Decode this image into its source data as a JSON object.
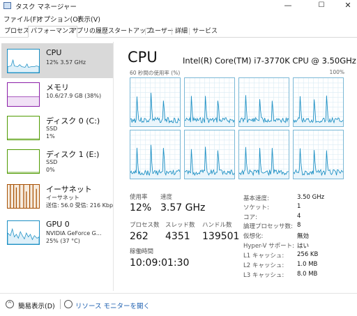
{
  "window": {
    "title": "タスク マネージャー",
    "minimize": "—",
    "maximize": "☐",
    "close": "✕"
  },
  "menu": [
    "ファイル(F)",
    "オプション(O)",
    "表示(V)"
  ],
  "tabs": [
    "プロセス",
    "パフォーマンス",
    "アプリの履歴",
    "スタートアップ",
    "ユーザー",
    "詳細",
    "サービス"
  ],
  "active_tab": "パフォーマンス",
  "sidebar": [
    {
      "name": "CPU",
      "sub1": "12%  3.57 GHz",
      "sub2": "",
      "sub3": "",
      "color": "#1b8fc4",
      "icon": "cpu-graph-icon"
    },
    {
      "name": "メモリ",
      "sub1": "10.6/27.9 GB (38%)",
      "sub2": "",
      "sub3": "",
      "color": "#8b1fa8",
      "icon": "memory-graph-icon"
    },
    {
      "name": "ディスク 0 (C:)",
      "sub1": "SSD",
      "sub2": "1%",
      "sub3": "",
      "color": "#4f9a00",
      "icon": "disk-graph-icon"
    },
    {
      "name": "ディスク 1 (E:)",
      "sub1": "SSD",
      "sub2": "0%",
      "sub3": "",
      "color": "#4f9a00",
      "icon": "disk-graph-icon"
    },
    {
      "name": "イーサネット",
      "sub1": "イーサネット",
      "sub2": "送信: 56.0  受信: 216 Kbp",
      "sub3": "",
      "color": "#a74f01",
      "icon": "ethernet-graph-icon"
    },
    {
      "name": "GPU 0",
      "sub1": "NVIDIA GeForce G...",
      "sub2": "25% (37 °C)",
      "sub3": "",
      "color": "#1b8fc4",
      "icon": "gpu-graph-icon"
    }
  ],
  "main": {
    "title": "CPU",
    "model": "Intel(R) Core(TM) i7-3770K CPU @ 3.50GHz",
    "graph_label": "60 秒間の使用率 (%)",
    "graph_max": "100%",
    "utilization_label": "使用率",
    "utilization": "12%",
    "speed_label": "速度",
    "speed": "3.57 GHz",
    "processes_label": "プロセス数",
    "processes": "262",
    "threads_label": "スレッド数",
    "threads": "4351",
    "handles_label": "ハンドル数",
    "handles": "139501",
    "uptime_label": "稼働時間",
    "uptime": "10:09:01:30"
  },
  "specs": [
    {
      "key": "基本速度:",
      "value": "3.50 GHz"
    },
    {
      "key": "ソケット:",
      "value": "1"
    },
    {
      "key": "コア:",
      "value": "4"
    },
    {
      "key": "論理プロセッサ数:",
      "value": "8"
    },
    {
      "key": "仮想化:",
      "value": "無効"
    },
    {
      "key": "Hyper-V サポート:",
      "value": "はい"
    },
    {
      "key": "L1 キャッシュ:",
      "value": "256 KB"
    },
    {
      "key": "L2 キャッシュ:",
      "value": "1.0 MB"
    },
    {
      "key": "L3 キャッシュ:",
      "value": "8.0 MB"
    }
  ],
  "footer": {
    "fewer_details": "簡易表示(D)",
    "resource_monitor": "リソース モニターを開く",
    "fewer_icon": "chevron-up-icon",
    "monitor_icon": "resource-monitor-icon"
  },
  "colors": {
    "cpu": "#1b8fc4",
    "memory": "#8b1fa8",
    "disk": "#4f9a00",
    "ethernet": "#a74f01",
    "grid": "#d9ebf4"
  }
}
